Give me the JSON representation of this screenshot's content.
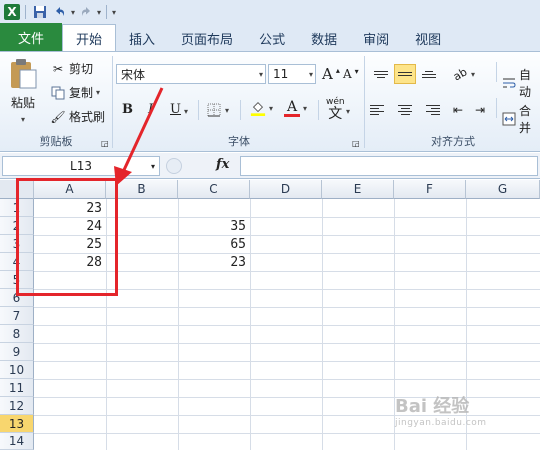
{
  "qat": {
    "logo": "X",
    "undo_icon": "undo-icon",
    "redo_icon": "redo-icon"
  },
  "tabs": [
    {
      "label": "文件"
    },
    {
      "label": "开始"
    },
    {
      "label": "插入"
    },
    {
      "label": "页面布局"
    },
    {
      "label": "公式"
    },
    {
      "label": "数据"
    },
    {
      "label": "审阅"
    },
    {
      "label": "视图"
    }
  ],
  "clipboard": {
    "paste": "粘贴",
    "cut": "剪切",
    "copy": "复制",
    "format_painter": "格式刷",
    "group": "剪贴板"
  },
  "font": {
    "name": "宋体",
    "size": "11",
    "bold": "B",
    "italic": "I",
    "underline": "U",
    "grow": "A",
    "shrink": "A",
    "wen": "wén",
    "wen_char": "文",
    "font_color": "A",
    "group": "字体"
  },
  "alignment": {
    "wrap": "自动",
    "merge": "合并",
    "group": "对齐方式"
  },
  "formula_bar": {
    "name_box": "L13",
    "fx": "fx"
  },
  "columns": [
    "A",
    "B",
    "C",
    "D",
    "E",
    "F",
    "G"
  ],
  "rows": [
    "1",
    "2",
    "3",
    "4",
    "5",
    "6",
    "7",
    "8",
    "9",
    "10",
    "11",
    "12",
    "13",
    "14"
  ],
  "cells": {
    "A1": "23",
    "A2": "24",
    "A3": "25",
    "A4": "28",
    "C2": "35",
    "C3": "65",
    "C4": "23"
  },
  "selected_row": "13",
  "colors": {
    "file_tab": "#2a8a3e",
    "annotation": "#e4252b",
    "selection": "#f8d66e"
  },
  "watermark": {
    "brand": "Bai 经验",
    "url": "jingyan.baidu.com"
  }
}
